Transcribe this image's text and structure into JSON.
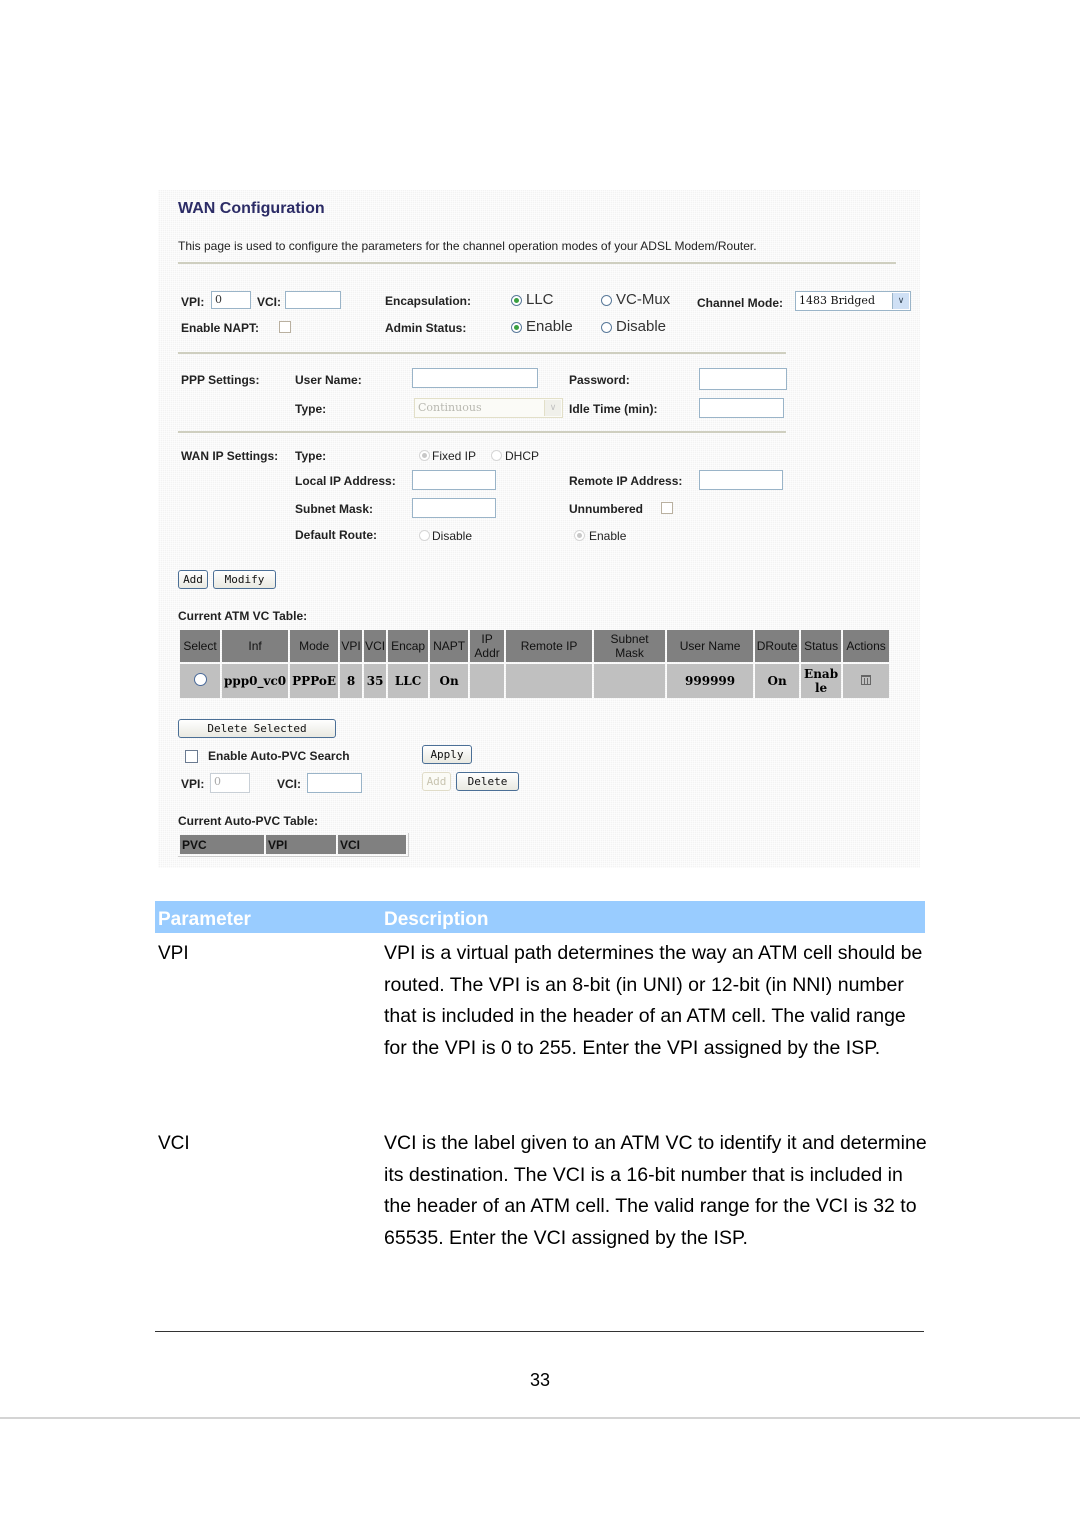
{
  "screenshot": {
    "title": "WAN Configuration",
    "intro": "This page is used to configure the parameters for the channel operation modes of your ADSL Modem/Router.",
    "vpi_label": "VPI:",
    "vpi_value": "0",
    "vci_label": "VCI:",
    "vci_value": "",
    "encapsulation_label": "Encapsulation:",
    "encapsulation_options": [
      "LLC",
      "VC-Mux"
    ],
    "encapsulation_selected": "LLC",
    "channel_mode_label": "Channel Mode:",
    "channel_mode_value": "1483 Bridged",
    "enable_napt_label": "Enable NAPT:",
    "enable_napt_checked": false,
    "admin_status_label": "Admin Status:",
    "admin_status_options": [
      "Enable",
      "Disable"
    ],
    "admin_status_selected": "Enable",
    "ppp": {
      "section_label": "PPP Settings:",
      "user_name_label": "User Name:",
      "user_name_value": "",
      "password_label": "Password:",
      "password_value": "",
      "type_label": "Type:",
      "type_value": "Continuous",
      "idle_time_label": "Idle Time (min):",
      "idle_time_value": ""
    },
    "wan_ip": {
      "section_label": "WAN IP Settings:",
      "type_label": "Type:",
      "type_options": [
        "Fixed IP",
        "DHCP"
      ],
      "type_selected": "Fixed IP",
      "local_ip_label": "Local IP Address:",
      "local_ip_value": "",
      "remote_ip_label": "Remote IP Address:",
      "remote_ip_value": "",
      "subnet_mask_label": "Subnet Mask:",
      "subnet_mask_value": "",
      "unnumbered_label": "Unnumbered",
      "unnumbered_checked": false,
      "default_route_label": "Default Route:",
      "default_route_options": [
        "Disable",
        "Enable"
      ],
      "default_route_selected": "Enable"
    },
    "buttons": {
      "add": "Add",
      "modify": "Modify",
      "delete_selected": "Delete Selected",
      "apply": "Apply",
      "pvc_add": "Add",
      "pvc_delete": "Delete"
    },
    "atm_table": {
      "caption": "Current ATM VC Table:",
      "headers": [
        "Select",
        "Inf",
        "Mode",
        "VPI",
        "VCI",
        "Encap",
        "NAPT",
        "IP Addr",
        "Remote IP",
        "Subnet Mask",
        "User Name",
        "DRoute",
        "Status",
        "Actions"
      ],
      "rows": [
        {
          "select": "",
          "inf": "ppp0_vc0",
          "mode": "PPPoE",
          "vpi": "8",
          "vci": "35",
          "encap": "LLC",
          "napt": "On",
          "ip_addr": "",
          "remote_ip": "",
          "subnet_mask": "",
          "user_name": "999999",
          "droute": "On",
          "status": "Enable",
          "actions": "trash-icon"
        }
      ]
    },
    "auto_pvc": {
      "enable_label": "Enable Auto-PVC Search",
      "enable_checked": false,
      "vpi_label": "VPI:",
      "vpi_value": "0",
      "vci_label": "VCI:",
      "vci_value": "",
      "table_caption": "Current Auto-PVC Table:",
      "headers": [
        "PVC",
        "VPI",
        "VCI"
      ]
    }
  },
  "parameter_table": {
    "headers": [
      "Parameter",
      "Description"
    ],
    "header_color": "#99ccff",
    "rows": [
      {
        "name": "VPI",
        "description": "VPI is a virtual path determines the way an ATM cell should be routed. The VPI is an 8-bit (in UNI) or 12-bit (in NNI) number that is included in the header of an ATM cell. The valid range for the VPI is 0 to 255. Enter the VPI assigned by the ISP."
      },
      {
        "name": "VCI",
        "description": "VCI is the label given to an ATM VC to identify it and determine its destination. The VCI is a 16-bit number that is included in the header of an ATM cell. The valid range for the VCI is 32 to 65535. Enter the VCI assigned by the ISP."
      }
    ]
  },
  "page_number": "33"
}
